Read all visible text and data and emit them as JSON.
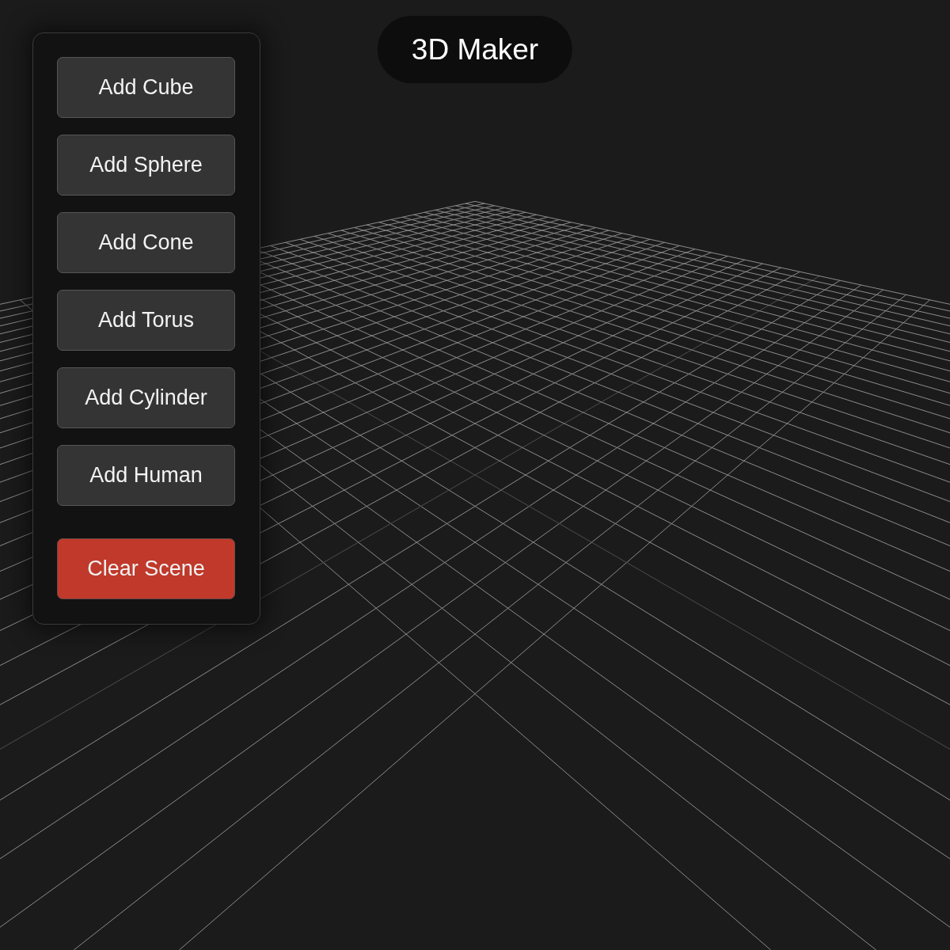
{
  "header": {
    "title": "3D Maker"
  },
  "panel": {
    "buttons": [
      {
        "label": "Add Cube",
        "kind": "add"
      },
      {
        "label": "Add Sphere",
        "kind": "add"
      },
      {
        "label": "Add Cone",
        "kind": "add"
      },
      {
        "label": "Add Torus",
        "kind": "add"
      },
      {
        "label": "Add Cylinder",
        "kind": "add"
      },
      {
        "label": "Add Human",
        "kind": "add"
      },
      {
        "label": "Clear Scene",
        "kind": "clear"
      }
    ]
  }
}
